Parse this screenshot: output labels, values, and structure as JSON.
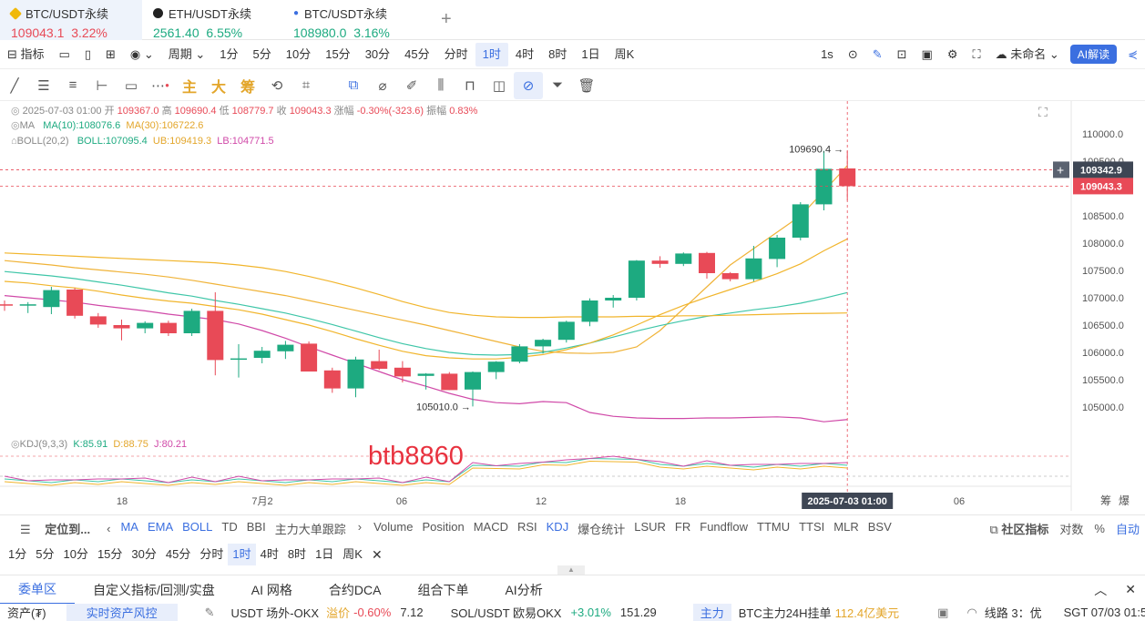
{
  "tabs": [
    {
      "name": "BTC/USDT永续",
      "price": "109043.1",
      "change": "3.22%",
      "color": "#e84a57"
    },
    {
      "name": "ETH/USDT永续",
      "price": "2561.40",
      "change": "6.55%",
      "color": "#1daa80"
    },
    {
      "name": "BTC/USDT永续",
      "price": "108980.0",
      "change": "3.16%",
      "color": "#1daa80"
    }
  ],
  "toolbar": {
    "indicator": "指标",
    "period": "周期",
    "intervals": [
      "1分",
      "5分",
      "10分",
      "15分",
      "30分",
      "45分",
      "分时",
      "1时",
      "4时",
      "8时",
      "1日",
      "周K"
    ],
    "selected_interval": "1时",
    "sec": "1s",
    "unnamed": "未命名",
    "ai_button": "AI解读"
  },
  "draw_toolbar": {
    "labels": [
      "主",
      "大",
      "筹"
    ]
  },
  "ohlc": {
    "time": "2025-07-03 01:00",
    "open_label": "开",
    "open": "109367.0",
    "high_label": "高",
    "high": "109690.4",
    "low_label": "低",
    "low": "108779.7",
    "close_label": "收",
    "close": "109043.3",
    "chg_label": "涨幅",
    "chg": "-0.30%(-323.6)",
    "amp_label": "振幅",
    "amp": "0.83%"
  },
  "ma": {
    "label": "MA",
    "ma10": "MA(10):108076.6",
    "ma30": "MA(30):106722.6"
  },
  "boll": {
    "label": "BOLL(20,2)",
    "mid": "BOLL:107095.4",
    "ub": "UB:109419.3",
    "lb": "LB:104771.5"
  },
  "kdj": {
    "label": "KDJ(9,3,3)",
    "k": "K:85.91",
    "d": "D:88.75",
    "j": "J:80.21"
  },
  "watermark": "btb8860",
  "annotations": {
    "high": "109690.4",
    "low": "105010.0"
  },
  "price_tags": {
    "cross": "109342.9",
    "last": "109043.3"
  },
  "yticks": [
    "110000.0",
    "109500.0",
    "108500.0",
    "108000.0",
    "107500.0",
    "107000.0",
    "106500.0",
    "106000.0",
    "105500.0",
    "105000.0"
  ],
  "xticks": [
    "18",
    "7月2",
    "06",
    "12",
    "18",
    "06"
  ],
  "x_cursor": "2025-07-03 01:00",
  "right_marks": [
    "筹",
    "爆"
  ],
  "indicator_bar": {
    "locate": "定位到...",
    "items": [
      "MA",
      "EMA",
      "BOLL",
      "TD",
      "BBI",
      "主力大单跟踪",
      "Volume",
      "Position",
      "MACD",
      "RSI",
      "KDJ",
      "爆仓统计",
      "LSUR",
      "FR",
      "Fundflow",
      "TTMU",
      "TTSI",
      "MLR",
      "BSV"
    ],
    "community": "社区指标",
    "log": "对数",
    "pct": "%",
    "auto": "自动"
  },
  "interval_bar": {
    "items": [
      "1分",
      "5分",
      "10分",
      "15分",
      "30分",
      "45分",
      "分时",
      "1时",
      "4时",
      "8时",
      "1日",
      "周K"
    ],
    "selected": "1时"
  },
  "bottom_tabs": [
    "委单区",
    "自定义指标/回测/实盘",
    "AI 网格",
    "合约DCA",
    "组合下单",
    "AI分析"
  ],
  "ticker": {
    "asset": "资产(₮)",
    "risk": "实时资产风控",
    "usdt": "USDT 场外-OKX",
    "premium_label": "溢价",
    "premium": "-0.60%",
    "usdt_price": "7.12",
    "sol": "SOL/USDT 欧易OKX",
    "sol_chg": "+3.01%",
    "sol_price": "151.29",
    "main_tag": "主力",
    "btc_main": "BTC主力24H挂单",
    "btc_amt": "112.4亿美元",
    "line": "线路 3：优",
    "time": "SGT 07/03 01:5"
  },
  "colors": {
    "up": "#1daa80",
    "down": "#e84a57",
    "ma10": "#f1b52c",
    "ma30": "#f1b52c",
    "boll_mid": "#3fc6a8",
    "boll_ub": "#f0b338",
    "boll_lb": "#d049a8",
    "accent": "#3b6fe0"
  },
  "chart_data": {
    "type": "candlestick",
    "ylim": [
      104800,
      110300
    ],
    "candles": [
      {
        "o": 106880,
        "h": 106950,
        "l": 106760,
        "c": 106870
      },
      {
        "o": 106860,
        "h": 106920,
        "l": 106720,
        "c": 106880
      },
      {
        "o": 106830,
        "h": 107200,
        "l": 106700,
        "c": 107140
      },
      {
        "o": 107150,
        "h": 107180,
        "l": 106620,
        "c": 106670
      },
      {
        "o": 106660,
        "h": 106720,
        "l": 106450,
        "c": 106510
      },
      {
        "o": 106500,
        "h": 106600,
        "l": 106220,
        "c": 106440
      },
      {
        "o": 106440,
        "h": 106570,
        "l": 106350,
        "c": 106540
      },
      {
        "o": 106540,
        "h": 106580,
        "l": 106300,
        "c": 106350
      },
      {
        "o": 106350,
        "h": 106800,
        "l": 106300,
        "c": 106760
      },
      {
        "o": 106760,
        "h": 107100,
        "l": 105580,
        "c": 105860
      },
      {
        "o": 105870,
        "h": 106150,
        "l": 105540,
        "c": 105890
      },
      {
        "o": 105900,
        "h": 106100,
        "l": 105800,
        "c": 106030
      },
      {
        "o": 106020,
        "h": 106210,
        "l": 105880,
        "c": 106140
      },
      {
        "o": 106160,
        "h": 106200,
        "l": 105650,
        "c": 105650
      },
      {
        "o": 105670,
        "h": 105720,
        "l": 105260,
        "c": 105340
      },
      {
        "o": 105340,
        "h": 105920,
        "l": 105180,
        "c": 105870
      },
      {
        "o": 105840,
        "h": 106050,
        "l": 105680,
        "c": 105700
      },
      {
        "o": 105720,
        "h": 105840,
        "l": 105450,
        "c": 105560
      },
      {
        "o": 105570,
        "h": 105620,
        "l": 105320,
        "c": 105610
      },
      {
        "o": 105610,
        "h": 105640,
        "l": 105310,
        "c": 105310
      },
      {
        "o": 105320,
        "h": 105650,
        "l": 105010,
        "c": 105640
      },
      {
        "o": 105640,
        "h": 105840,
        "l": 105510,
        "c": 105830
      },
      {
        "o": 105830,
        "h": 106150,
        "l": 105800,
        "c": 106110
      },
      {
        "o": 106110,
        "h": 106250,
        "l": 105980,
        "c": 106230
      },
      {
        "o": 106230,
        "h": 106580,
        "l": 106180,
        "c": 106560
      },
      {
        "o": 106560,
        "h": 106990,
        "l": 106480,
        "c": 106950
      },
      {
        "o": 106950,
        "h": 107050,
        "l": 106820,
        "c": 107000
      },
      {
        "o": 107000,
        "h": 107690,
        "l": 106950,
        "c": 107680
      },
      {
        "o": 107680,
        "h": 107760,
        "l": 107550,
        "c": 107620
      },
      {
        "o": 107620,
        "h": 107830,
        "l": 107580,
        "c": 107810
      },
      {
        "o": 107820,
        "h": 107840,
        "l": 107350,
        "c": 107450
      },
      {
        "o": 107450,
        "h": 107470,
        "l": 107300,
        "c": 107340
      },
      {
        "o": 107340,
        "h": 107950,
        "l": 107300,
        "c": 107720
      },
      {
        "o": 107710,
        "h": 108150,
        "l": 107560,
        "c": 108100
      },
      {
        "o": 108100,
        "h": 108750,
        "l": 108050,
        "c": 108710
      },
      {
        "o": 108710,
        "h": 109690,
        "l": 108600,
        "c": 109360
      },
      {
        "o": 109367,
        "h": 109690,
        "l": 108780,
        "c": 109043
      }
    ],
    "ma10": [
      107300,
      107270,
      107220,
      107180,
      107120,
      107050,
      106990,
      106940,
      106900,
      106840,
      106780,
      106700,
      106600,
      106500,
      106380,
      106250,
      106130,
      106020,
      105940,
      105900,
      105880,
      105880,
      105910,
      105960,
      106050,
      106170,
      106320,
      106500,
      106690,
      106860,
      107010,
      107150,
      107290,
      107440,
      107620,
      107860,
      108076
    ],
    "ma30": [
      107820,
      107800,
      107780,
      107760,
      107740,
      107720,
      107700,
      107680,
      107660,
      107640,
      107600,
      107550,
      107480,
      107390,
      107290,
      107180,
      107060,
      106930,
      106820,
      106730,
      106680,
      106650,
      106640,
      106640,
      106650,
      106650,
      106650,
      106660,
      106660,
      106670,
      106670,
      106680,
      106690,
      106700,
      106710,
      106715,
      106722
    ],
    "boll_mid": [
      107480,
      107440,
      107400,
      107350,
      107290,
      107230,
      107160,
      107090,
      107030,
      106950,
      106880,
      106800,
      106720,
      106620,
      106510,
      106390,
      106270,
      106160,
      106070,
      106000,
      105960,
      105950,
      105960,
      106000,
      106080,
      106170,
      106280,
      106390,
      106490,
      106580,
      106660,
      106720,
      106780,
      106830,
      106900,
      106990,
      107095
    ],
    "boll_ub": [
      107680,
      107640,
      107600,
      107550,
      107510,
      107470,
      107430,
      107380,
      107320,
      107250,
      107180,
      107110,
      107040,
      106950,
      106860,
      106770,
      106680,
      106590,
      106500,
      106400,
      106300,
      106200,
      106100,
      106020,
      105990,
      105980,
      106000,
      106100,
      106400,
      106800,
      107200,
      107600,
      107900,
      108200,
      108500,
      108950,
      109419
    ],
    "boll_lb": [
      107040,
      107000,
      106960,
      106920,
      106860,
      106810,
      106760,
      106700,
      106650,
      106600,
      106520,
      106400,
      106260,
      106100,
      105950,
      105800,
      105650,
      105500,
      105380,
      105250,
      105140,
      105080,
      105060,
      105100,
      105080,
      104900,
      104830,
      104800,
      104790,
      104790,
      104800,
      104800,
      104810,
      104820,
      104800,
      104730,
      104771
    ]
  }
}
